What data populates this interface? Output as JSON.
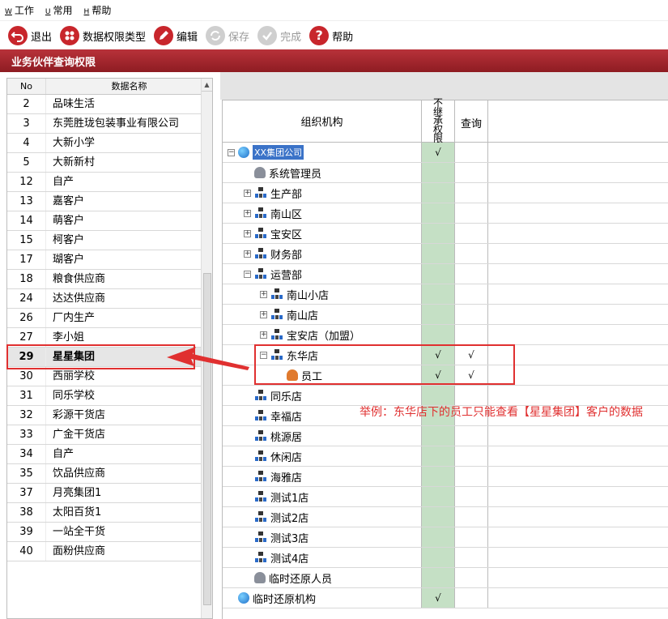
{
  "menubar": [
    {
      "key": "W",
      "label": "工作"
    },
    {
      "key": "U",
      "label": "常用"
    },
    {
      "key": "H",
      "label": "帮助"
    }
  ],
  "toolbar": {
    "exit": "退出",
    "perm_type": "数据权限类型",
    "edit": "编辑",
    "save": "保存",
    "done": "完成",
    "help": "帮助"
  },
  "window_title": "业务伙伴查询权限",
  "left_list": {
    "col_no": "No",
    "col_name": "数据名称",
    "rows": [
      {
        "no": "2",
        "name": "品味生活"
      },
      {
        "no": "3",
        "name": "东莞胜珑包装事业有限公司"
      },
      {
        "no": "4",
        "name": "大新小学"
      },
      {
        "no": "5",
        "name": "大新新村"
      },
      {
        "no": "12",
        "name": "自产"
      },
      {
        "no": "13",
        "name": "嘉客户"
      },
      {
        "no": "14",
        "name": "萌客户"
      },
      {
        "no": "15",
        "name": "柯客户"
      },
      {
        "no": "17",
        "name": "瑚客户"
      },
      {
        "no": "18",
        "name": "粮食供应商"
      },
      {
        "no": "24",
        "name": "达达供应商"
      },
      {
        "no": "26",
        "name": "厂内生产"
      },
      {
        "no": "27",
        "name": "李小姐"
      },
      {
        "no": "29",
        "name": "星星集团"
      },
      {
        "no": "30",
        "name": "西丽学校"
      },
      {
        "no": "31",
        "name": "同乐学校"
      },
      {
        "no": "32",
        "name": "彩源干货店"
      },
      {
        "no": "33",
        "name": "广金干货店"
      },
      {
        "no": "34",
        "name": "自产"
      },
      {
        "no": "35",
        "name": "饮品供应商"
      },
      {
        "no": "37",
        "name": "月亮集团1"
      },
      {
        "no": "38",
        "name": "太阳百货1"
      },
      {
        "no": "39",
        "name": "一站全干货"
      },
      {
        "no": "40",
        "name": "面粉供应商"
      }
    ]
  },
  "grid": {
    "col_org": "组织机构",
    "col_inherit": "不继承权限",
    "col_query": "查询",
    "check_mark": "√"
  },
  "tree": [
    {
      "label": "XX集团公司",
      "icon": "globe-icon",
      "expander": "−",
      "inherit": "√",
      "query": ""
    },
    {
      "label": "系统管理员",
      "icon": "person-icon",
      "expander": "",
      "inherit": "",
      "query": ""
    },
    {
      "label": "生产部",
      "icon": "org-icon",
      "expander": "+",
      "inherit": "",
      "query": ""
    },
    {
      "label": "南山区",
      "icon": "org-icon",
      "expander": "+",
      "inherit": "",
      "query": ""
    },
    {
      "label": "宝安区",
      "icon": "org-icon",
      "expander": "+",
      "inherit": "",
      "query": ""
    },
    {
      "label": "财务部",
      "icon": "org-icon",
      "expander": "+",
      "inherit": "",
      "query": ""
    },
    {
      "label": "运营部",
      "icon": "org-icon",
      "expander": "−",
      "inherit": "",
      "query": ""
    },
    {
      "label": "南山小店",
      "icon": "org-icon",
      "expander": "+",
      "inherit": "",
      "query": ""
    },
    {
      "label": "南山店",
      "icon": "org-icon",
      "expander": "+",
      "inherit": "",
      "query": ""
    },
    {
      "label": "宝安店（加盟）",
      "icon": "org-icon",
      "expander": "+",
      "inherit": "",
      "query": ""
    },
    {
      "label": "东华店",
      "icon": "org-icon",
      "expander": "−",
      "inherit": "√",
      "query": "√"
    },
    {
      "label": "员工",
      "icon": "staff-icon",
      "expander": "",
      "inherit": "√",
      "query": "√"
    },
    {
      "label": "同乐店",
      "icon": "org-icon",
      "expander": "",
      "inherit": "",
      "query": ""
    },
    {
      "label": "幸福店",
      "icon": "org-icon",
      "expander": "",
      "inherit": "",
      "query": ""
    },
    {
      "label": "桃源居",
      "icon": "org-icon",
      "expander": "",
      "inherit": "",
      "query": ""
    },
    {
      "label": "休闲店",
      "icon": "org-icon",
      "expander": "",
      "inherit": "",
      "query": ""
    },
    {
      "label": "海雅店",
      "icon": "org-icon",
      "expander": "",
      "inherit": "",
      "query": ""
    },
    {
      "label": "测试1店",
      "icon": "org-icon",
      "expander": "",
      "inherit": "",
      "query": ""
    },
    {
      "label": "测试2店",
      "icon": "org-icon",
      "expander": "",
      "inherit": "",
      "query": ""
    },
    {
      "label": "测试3店",
      "icon": "org-icon",
      "expander": "",
      "inherit": "",
      "query": ""
    },
    {
      "label": "测试4店",
      "icon": "org-icon",
      "expander": "",
      "inherit": "",
      "query": ""
    },
    {
      "label": "临时还原人员",
      "icon": "person-icon",
      "expander": "",
      "inherit": "",
      "query": ""
    },
    {
      "label": "临时还原机构",
      "icon": "globe-icon",
      "expander": "",
      "inherit": "√",
      "query": ""
    }
  ],
  "annotation": "举例：东华店下的员工只能查看【星星集团】客户的数据",
  "colors": {
    "accent": "#e03030",
    "title_bar": "#a52a31",
    "inherit_column": "#c5e0c5"
  }
}
